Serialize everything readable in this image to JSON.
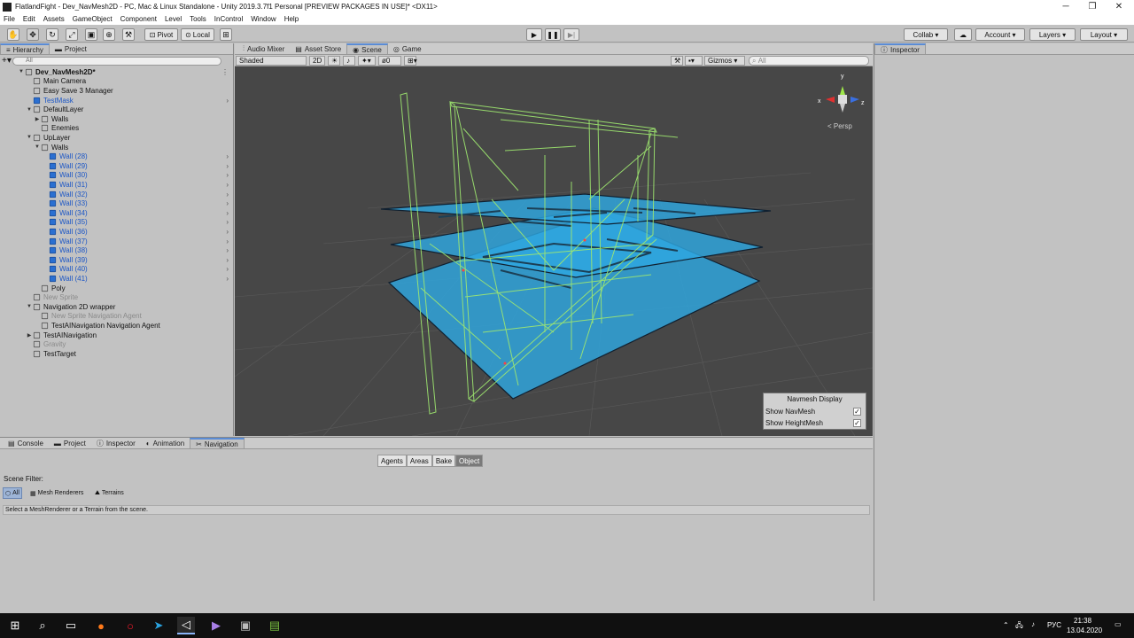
{
  "window": {
    "title": "FlatlandFight - Dev_NavMesh2D - PC, Mac & Linux Standalone - Unity 2019.3.7f1 Personal [PREVIEW PACKAGES IN USE]* <DX11>"
  },
  "menu": [
    "File",
    "Edit",
    "Assets",
    "GameObject",
    "Component",
    "Level",
    "Tools",
    "InControl",
    "Window",
    "Help"
  ],
  "toolbar": {
    "pivot": "Pivot",
    "local": "Local",
    "collab": "Collab ▾",
    "account": "Account",
    "layers": "Layers",
    "layout": "Layout"
  },
  "hierarchy": {
    "tabs": [
      "Hierarchy",
      "Project"
    ],
    "search_placeholder": "All",
    "rows": [
      {
        "label": "Dev_NavMesh2D*",
        "indent": 0,
        "arrow": "▼",
        "style": "bold",
        "icon": "scene"
      },
      {
        "label": "Main Camera",
        "indent": 1,
        "arrow": "",
        "style": "",
        "icon": "cube"
      },
      {
        "label": "Easy Save 3 Manager",
        "indent": 1,
        "arrow": "",
        "style": "",
        "icon": "cube"
      },
      {
        "label": "TestMask",
        "indent": 1,
        "arrow": "",
        "style": "blue",
        "icon": "blue",
        "more": true
      },
      {
        "label": "DefaultLayer",
        "indent": 1,
        "arrow": "▼",
        "style": "",
        "icon": "cube"
      },
      {
        "label": "Walls",
        "indent": 2,
        "arrow": "▶",
        "style": "",
        "icon": "cube"
      },
      {
        "label": "Enemies",
        "indent": 2,
        "arrow": "",
        "style": "",
        "icon": "cube"
      },
      {
        "label": "UpLayer",
        "indent": 1,
        "arrow": "▼",
        "style": "",
        "icon": "cube"
      },
      {
        "label": "Walls",
        "indent": 2,
        "arrow": "▼",
        "style": "",
        "icon": "cube"
      },
      {
        "label": "Wall (28)",
        "indent": 3,
        "arrow": "",
        "style": "blue",
        "icon": "blue",
        "more": true
      },
      {
        "label": "Wall (29)",
        "indent": 3,
        "arrow": "",
        "style": "blue",
        "icon": "blue",
        "more": true
      },
      {
        "label": "Wall (30)",
        "indent": 3,
        "arrow": "",
        "style": "blue",
        "icon": "blue",
        "more": true
      },
      {
        "label": "Wall (31)",
        "indent": 3,
        "arrow": "",
        "style": "blue",
        "icon": "blue",
        "more": true
      },
      {
        "label": "Wall (32)",
        "indent": 3,
        "arrow": "",
        "style": "blue",
        "icon": "blue",
        "more": true
      },
      {
        "label": "Wall (33)",
        "indent": 3,
        "arrow": "",
        "style": "blue",
        "icon": "blue",
        "more": true
      },
      {
        "label": "Wall (34)",
        "indent": 3,
        "arrow": "",
        "style": "blue",
        "icon": "blue",
        "more": true
      },
      {
        "label": "Wall (35)",
        "indent": 3,
        "arrow": "",
        "style": "blue",
        "icon": "blue",
        "more": true
      },
      {
        "label": "Wall (36)",
        "indent": 3,
        "arrow": "",
        "style": "blue",
        "icon": "blue",
        "more": true
      },
      {
        "label": "Wall (37)",
        "indent": 3,
        "arrow": "",
        "style": "blue",
        "icon": "blue",
        "more": true
      },
      {
        "label": "Wall (38)",
        "indent": 3,
        "arrow": "",
        "style": "blue",
        "icon": "blue",
        "more": true
      },
      {
        "label": "Wall (39)",
        "indent": 3,
        "arrow": "",
        "style": "blue",
        "icon": "blue",
        "more": true
      },
      {
        "label": "Wall (40)",
        "indent": 3,
        "arrow": "",
        "style": "blue",
        "icon": "blue",
        "more": true
      },
      {
        "label": "Wall (41)",
        "indent": 3,
        "arrow": "",
        "style": "blue",
        "icon": "blue",
        "more": true
      },
      {
        "label": "Poly",
        "indent": 2,
        "arrow": "",
        "style": "",
        "icon": "cube"
      },
      {
        "label": "New Sprite",
        "indent": 1,
        "arrow": "",
        "style": "grey",
        "icon": "cube"
      },
      {
        "label": "Navigation 2D wrapper",
        "indent": 1,
        "arrow": "▼",
        "style": "",
        "icon": "cube"
      },
      {
        "label": "New Sprite Navigation Agent",
        "indent": 2,
        "arrow": "",
        "style": "grey",
        "icon": "cube"
      },
      {
        "label": "TestAINavigation Navigation Agent",
        "indent": 2,
        "arrow": "",
        "style": "",
        "icon": "cube"
      },
      {
        "label": "TestAINavigation",
        "indent": 1,
        "arrow": "▶",
        "style": "",
        "icon": "cube"
      },
      {
        "label": "Gravity",
        "indent": 1,
        "arrow": "",
        "style": "grey",
        "icon": "cube"
      },
      {
        "label": "TestTarget",
        "indent": 1,
        "arrow": "",
        "style": "",
        "icon": "cube"
      }
    ]
  },
  "scene": {
    "tabs": [
      "Audio Mixer",
      "Asset Store",
      "Scene",
      "Game"
    ],
    "shading": "Shaded",
    "mode2d": "2D",
    "hidden_count": "0",
    "gizmos": "Gizmos",
    "search_placeholder": "All",
    "persp": "< Persp",
    "axis_x": "x",
    "axis_y": "y",
    "axis_z": "z",
    "navmesh_display": {
      "title": "Navmesh Display",
      "show_navmesh": "Show NavMesh",
      "show_heightmesh": "Show HeightMesh"
    }
  },
  "inspector": {
    "tab": "Inspector"
  },
  "bottom": {
    "tabs": [
      "Console",
      "Project",
      "Inspector",
      "Animation",
      "Navigation"
    ],
    "nav_tabs": [
      "Agents",
      "Areas",
      "Bake",
      "Object"
    ],
    "scene_filter": "Scene Filter:",
    "filters": [
      "All",
      "Mesh Renderers",
      "Terrains"
    ],
    "help": "Select a MeshRenderer or a Terrain from the scene."
  },
  "taskbar": {
    "lang": "РУС",
    "time": "21:38",
    "date": "13.04.2020"
  }
}
